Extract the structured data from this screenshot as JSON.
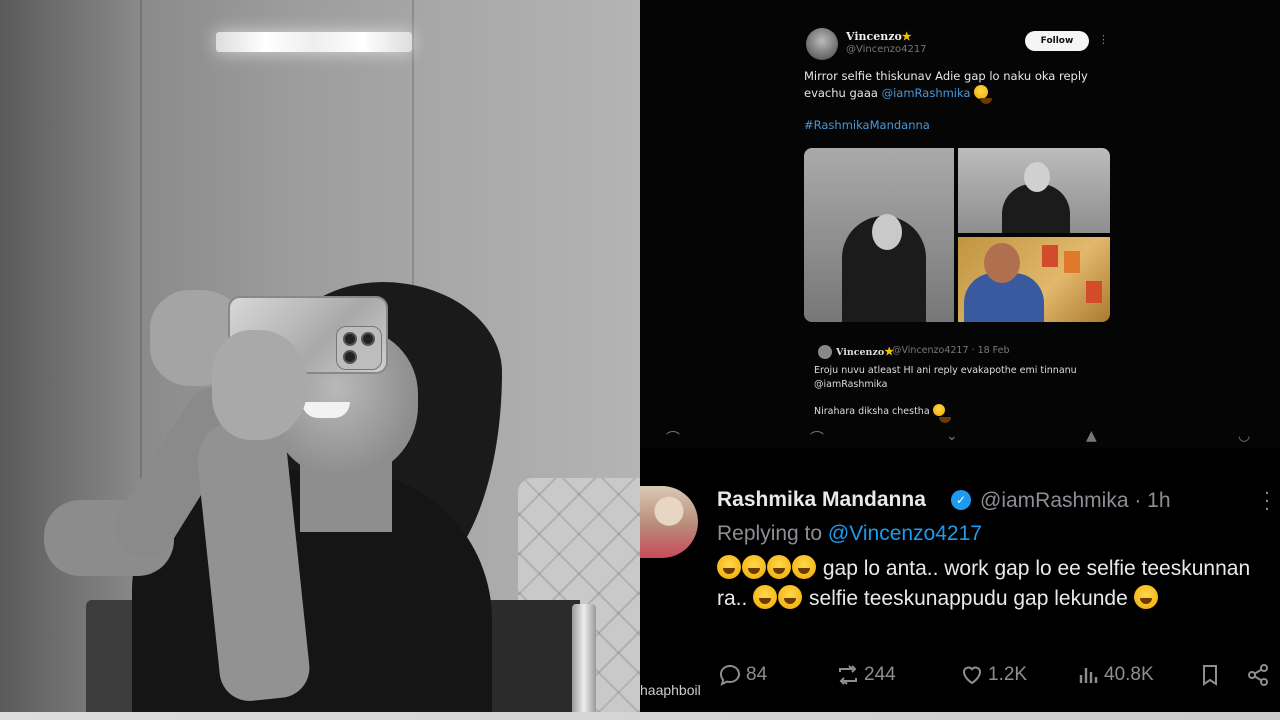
{
  "embedded_tweet": {
    "name": "Vincenzo",
    "handle": "@Vincenzo4217",
    "follow_label": "Follow",
    "text": "Mirror selfie thiskunav Adie gap lo naku oka reply evachu gaaa",
    "mention": "@iamRashmika",
    "hashtag": "#RashmikaMandanna",
    "quoted": {
      "name": "Vincenzo",
      "handle": "@Vincenzo4217 · 18 Feb",
      "text": "Eroju nuvu atleast HI ani reply evakapothe emi tinnanu @iamRashmika",
      "text2": "Nirahara diksha chestha"
    }
  },
  "reply_tweet": {
    "name": "Rashmika Mandanna",
    "handle": "@iamRashmika · 1h",
    "replying_prefix": "Replying to",
    "replying_to": "@Vincenzo4217",
    "text_part1": "gap lo anta.. work gap lo ee selfie teeskunnan ra..",
    "text_part2": "selfie teeskunappudu gap lekunde",
    "stats": {
      "replies": "84",
      "reposts": "244",
      "likes": "1.2K",
      "views": "40.8K"
    }
  },
  "watermark": "haaphboil",
  "colors": {
    "accent": "#1d9bf0",
    "text": "#e7e9ea",
    "muted": "#8b8f93",
    "background": "#000000"
  }
}
